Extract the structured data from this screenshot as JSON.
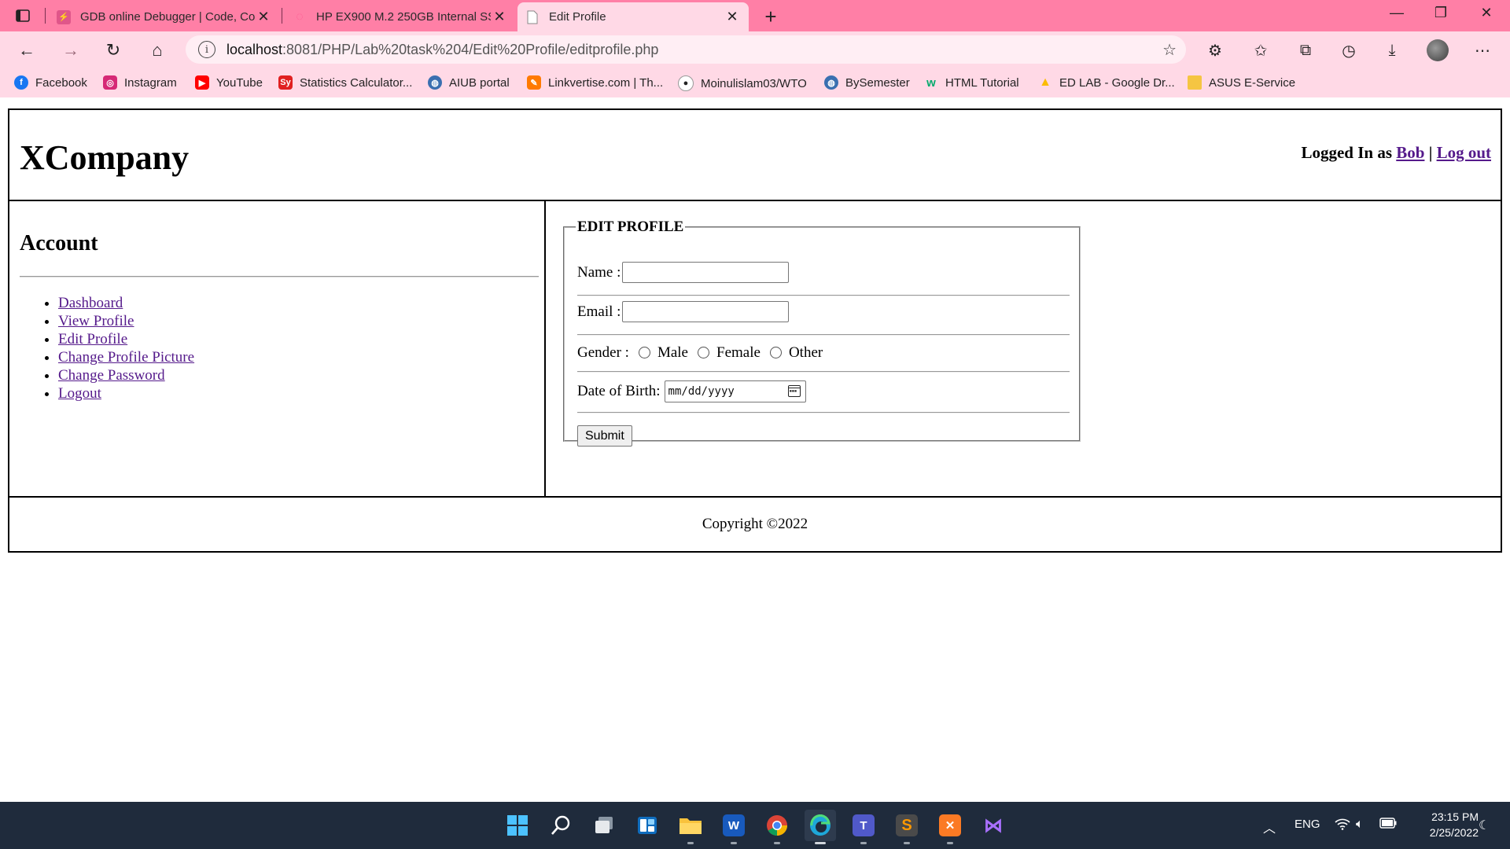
{
  "browser": {
    "tabs": [
      {
        "title": "GDB online Debugger | Code, Co",
        "favicon_color": "#e0568a"
      },
      {
        "title": "HP EX900 M.2 250GB Internal SS",
        "favicon_color": "#ff6fa0"
      },
      {
        "title": "Edit Profile",
        "favicon_color": "#ffffff",
        "active": true
      }
    ],
    "address": {
      "host": "localhost",
      "path": ":8081/PHP/Lab%20task%204/Edit%20Profile/editprofile.php"
    },
    "bookmarks": [
      {
        "label": "Facebook",
        "icon": "facebook-icon",
        "color": "#1877f2"
      },
      {
        "label": "Instagram",
        "icon": "instagram-icon",
        "color": "#d62976"
      },
      {
        "label": "YouTube",
        "icon": "youtube-icon",
        "color": "#ff0000"
      },
      {
        "label": "Statistics Calculator...",
        "icon": "sy-icon",
        "color": "#e02020"
      },
      {
        "label": "AIUB portal",
        "icon": "globe-icon",
        "color": "#3a6fb0"
      },
      {
        "label": "Linkvertise.com | Th...",
        "icon": "linkvertise-icon",
        "color": "#ff7a00"
      },
      {
        "label": "Moinulislam03/WTO",
        "icon": "github-icon",
        "color": "#ffffff"
      },
      {
        "label": "BySemester",
        "icon": "globe-icon",
        "color": "#3a6fb0"
      },
      {
        "label": "HTML Tutorial",
        "icon": "w3schools-icon",
        "color": "#04aa6d"
      },
      {
        "label": "ED LAB - Google Dr...",
        "icon": "google-drive-icon",
        "color": "#fbbc04"
      },
      {
        "label": "ASUS E-Service",
        "icon": "folder-icon",
        "color": "#f5c542"
      }
    ]
  },
  "page": {
    "brand": "XCompany",
    "login": {
      "prefix": "Logged In as ",
      "user": "Bob",
      "separator": " | ",
      "logout": "Log out"
    },
    "sidebar": {
      "title": "Account",
      "items": [
        "Dashboard",
        "View Profile",
        "Edit Profile",
        "Change Profile Picture",
        "Change Password",
        "Logout"
      ]
    },
    "form": {
      "legend": "EDIT PROFILE",
      "name_label": "Name :",
      "name_value": "",
      "email_label": "Email :",
      "email_value": "",
      "gender_label": "Gender :",
      "gender_options": [
        "Male",
        "Female",
        "Other"
      ],
      "dob_label": "Date of Birth:",
      "dob_placeholder": "mm/dd/yyyy",
      "submit_label": "Submit"
    },
    "footer": "Copyright ©2022"
  },
  "taskbar": {
    "tray": {
      "language": "ENG",
      "time": "23:15 PM",
      "date": "2/25/2022"
    }
  }
}
